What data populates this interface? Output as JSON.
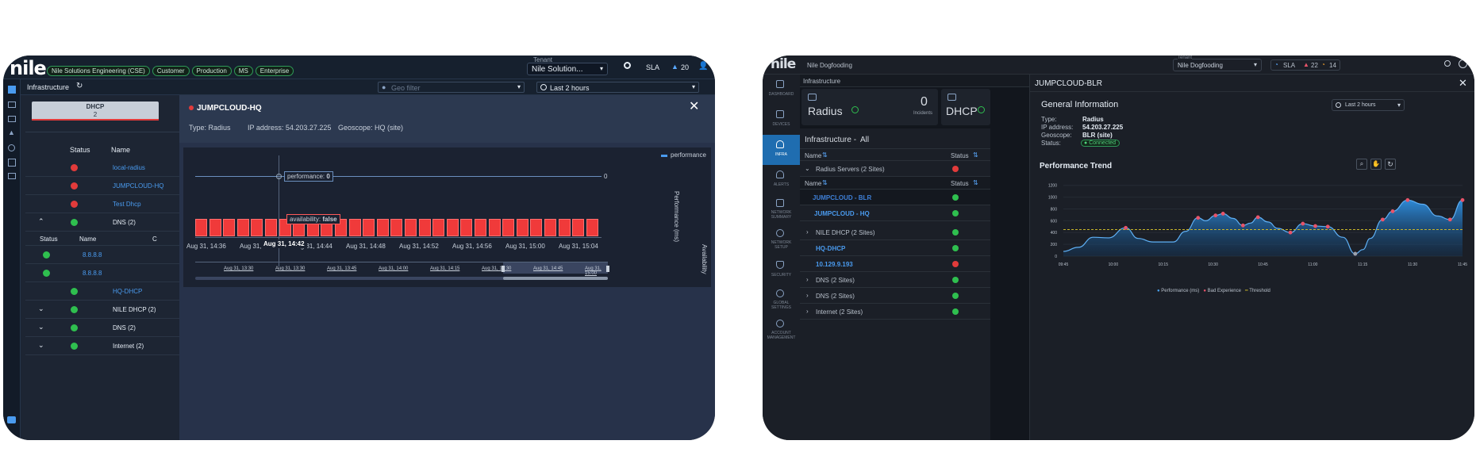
{
  "left": {
    "logo": "nile",
    "tags": [
      "Nile Solutions Engineering (CSE)",
      "Customer",
      "Production",
      "MS",
      "Enterprise"
    ],
    "tenant_label": "Tenant",
    "tenant_value": "Nile Solution...",
    "sla": "SLA",
    "alert_count": "20",
    "breadcrumb": "Infrastructure",
    "geo_placeholder": "Geo filter",
    "time_range": "Last 2 hours",
    "dhcp_card": {
      "label": "DHCP",
      "count": "2"
    },
    "table_headers": {
      "status": "Status",
      "name": "Name"
    },
    "rows": [
      {
        "name": "local-radius",
        "status": "red",
        "link": true
      },
      {
        "name": "JUMPCLOUD-HQ",
        "status": "red",
        "link": true
      },
      {
        "name": "Test Dhcp",
        "status": "red",
        "link": true
      },
      {
        "name": "DNS (2)",
        "status": "green",
        "link": false,
        "expander": "^"
      },
      {
        "name": "HQ-DHCP",
        "status": "green",
        "link": true
      },
      {
        "name": "NILE DHCP (2)",
        "status": "green",
        "link": false,
        "expander": "v"
      },
      {
        "name": "DNS (2)",
        "status": "green",
        "link": false,
        "expander": "v"
      },
      {
        "name": "Internet (2)",
        "status": "green",
        "link": false,
        "expander": "v"
      }
    ],
    "sub_headers": {
      "status": "Status",
      "name": "Name",
      "col3": "C"
    },
    "sub_rows": [
      {
        "name": "8.8.8.8"
      },
      {
        "name": "8.8.8.8"
      }
    ],
    "panel": {
      "title": "JUMPCLOUD-HQ",
      "type": "Type: Radius",
      "ip": "IP address: 54.203.27.225",
      "geo": "Geoscope: HQ (site)",
      "legend": "performance",
      "perf_axis": "Performance (ms)",
      "avail_axis": "Availability",
      "perf_tooltip_label": "performance:",
      "perf_tooltip_value": "0",
      "avail_tooltip_label": "availability:",
      "avail_tooltip_value": "false",
      "perf_right_value": "0",
      "cursor_time": "Aug 31, 14:42",
      "x_ticks": [
        "Aug 31, 14:36",
        "Aug 31, 14:40",
        "Aug 31, 14:44",
        "Aug 31, 14:48",
        "Aug 31, 14:52",
        "Aug 31, 14:56",
        "Aug 31, 15:00",
        "Aug 31, 15:04"
      ],
      "nav_ticks": [
        "Aug 31, 13:30",
        "Aug 31, 13:30",
        "Aug 31, 13:45",
        "Aug 31, 14:00",
        "Aug 31, 14:15",
        "Aug 31, 14:30",
        "Aug 31, 14:45",
        "Aug 31, 15:00"
      ],
      "bar_count": 29
    }
  },
  "right": {
    "logo": "nile",
    "org": "Nile Dogfooding",
    "tenant_label": "Tenant",
    "tenant_value": "Nile Dogfooding",
    "sla": "SLA",
    "alerts_a": "22",
    "alerts_b": "14",
    "breadcrumb": "Infrastructure",
    "nav": [
      "DASHBOARD",
      "DEVICES",
      "INFRA",
      "ALERTS",
      "NETWORK SUMMARY",
      "NETWORK SETUP",
      "SECURITY",
      "GLOBAL SETTINGS",
      "ACCOUNT MANAGEMENT"
    ],
    "cards": [
      {
        "name": "Radius",
        "count": "0",
        "sub": "Incidents"
      },
      {
        "name": "DHCP"
      }
    ],
    "infra_title": "Infrastructure -",
    "infra_filter": "All",
    "headers": {
      "name": "Name",
      "status": "Status"
    },
    "group1": "Radius Servers (2 Sites)",
    "group1_rows": [
      "JUMPCLOUD - BLR",
      "JUMPCLOUD - HQ"
    ],
    "group2": "NILE DHCP (2 Sites)",
    "group2_rows": [
      "HQ-DHCP",
      "10.129.9.193"
    ],
    "groups_tail": [
      "DNS (2 Sites)",
      "DNS (2 Sites)",
      "Internet (2 Sites)"
    ],
    "detail": {
      "title": "JUMPCLOUD-BLR",
      "general": "General Information",
      "time_range": "Last 2 hours",
      "type_k": "Type:",
      "type_v": "Radius",
      "ip_k": "IP address:",
      "ip_v": "54.203.27.225",
      "geo_k": "Geoscope:",
      "geo_v": "BLR (site)",
      "status_k": "Status:",
      "status_v": "Connected",
      "trend_title": "Performance Trend"
    },
    "colors": {
      "accent": "#2f8fe0",
      "bad": "#e8546a",
      "threshold": "#c8b52a"
    }
  },
  "chart_data": [
    {
      "type": "area",
      "title": "Performance Trend",
      "x": [
        "09:45",
        "10:00",
        "10:15",
        "10:30",
        "10:45",
        "11:00",
        "11:15",
        "11:30",
        "11:45"
      ],
      "y_ticks": [
        0,
        200,
        400,
        600,
        800,
        1000,
        1200
      ],
      "ylim": [
        0,
        1250
      ],
      "threshold": 450,
      "series": [
        {
          "name": "Performance (ms)",
          "points": [
            [
              0,
              80
            ],
            [
              0.3,
              150
            ],
            [
              0.6,
              320
            ],
            [
              0.9,
              310
            ],
            [
              1.25,
              480
            ],
            [
              1.5,
              300
            ],
            [
              1.8,
              240
            ],
            [
              2.2,
              240
            ],
            [
              2.45,
              420
            ],
            [
              2.7,
              650
            ],
            [
              2.85,
              600
            ],
            [
              3.05,
              690
            ],
            [
              3.2,
              720
            ],
            [
              3.4,
              640
            ],
            [
              3.6,
              520
            ],
            [
              3.75,
              560
            ],
            [
              3.9,
              660
            ],
            [
              4.1,
              580
            ],
            [
              4.3,
              470
            ],
            [
              4.55,
              400
            ],
            [
              4.8,
              550
            ],
            [
              5.05,
              510
            ],
            [
              5.3,
              500
            ],
            [
              5.6,
              320
            ],
            [
              5.85,
              40
            ],
            [
              6.0,
              110
            ],
            [
              6.15,
              300
            ],
            [
              6.4,
              620
            ],
            [
              6.6,
              760
            ],
            [
              6.9,
              950
            ],
            [
              7.2,
              880
            ],
            [
              7.5,
              680
            ],
            [
              7.75,
              620
            ],
            [
              8.0,
              950
            ]
          ]
        },
        {
          "name": "Bad Experience",
          "points": [
            [
              1.25,
              480
            ],
            [
              2.7,
              650
            ],
            [
              3.05,
              690
            ],
            [
              3.2,
              720
            ],
            [
              3.6,
              520
            ],
            [
              3.9,
              660
            ],
            [
              4.55,
              400
            ],
            [
              4.8,
              550
            ],
            [
              5.05,
              510
            ],
            [
              5.3,
              500
            ],
            [
              5.85,
              40
            ],
            [
              6.4,
              620
            ],
            [
              6.6,
              760
            ],
            [
              6.9,
              950
            ],
            [
              7.75,
              620
            ],
            [
              8.0,
              950
            ]
          ]
        }
      ],
      "legend": [
        "Performance (ms)",
        "Bad Experience",
        "Threshold"
      ],
      "legend_position": "bottom"
    }
  ]
}
